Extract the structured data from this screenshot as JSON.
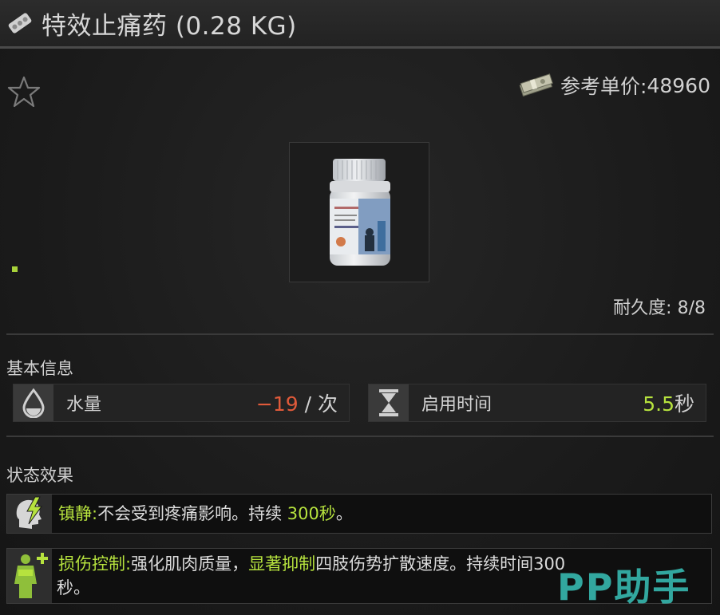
{
  "header": {
    "title": "特效止痛药 (0.28 KG)",
    "icon": "pill-blister-icon"
  },
  "item": {
    "price_label": "参考单价:",
    "price_value": "48960",
    "durability_label": "耐久度:",
    "durability_value": "8/8",
    "image": "pill-bottle"
  },
  "basic_info": {
    "title": "基本信息",
    "stats": [
      {
        "label": "水量",
        "value": "−19",
        "unit": " / 次",
        "icon": "water-drop-icon",
        "value_color": "#e05a3a"
      },
      {
        "label": "启用时间",
        "value": "5.5",
        "unit": "秒",
        "icon": "hourglass-icon",
        "value_color": "#b6e23e"
      }
    ]
  },
  "status_effects": {
    "title": "状态效果",
    "effects": [
      {
        "icon": "painkiller-head-icon",
        "name": "镇静",
        "colon": ":",
        "text_a": "不会受到疼痛影响。持续 ",
        "highlight": "300秒",
        "text_b": "。"
      },
      {
        "icon": "body-damage-control-icon",
        "name": "损伤控制",
        "colon": ":",
        "text_a": "强化肌肉质量，",
        "highlight": "显著抑制",
        "text_b": "四肢伤势扩散速度。持续时间300",
        "line2": "秒。"
      }
    ]
  },
  "watermark": "PP助手",
  "colors": {
    "accent_green": "#b6e23e",
    "negative_red": "#e05a3a",
    "background": "#161616"
  }
}
